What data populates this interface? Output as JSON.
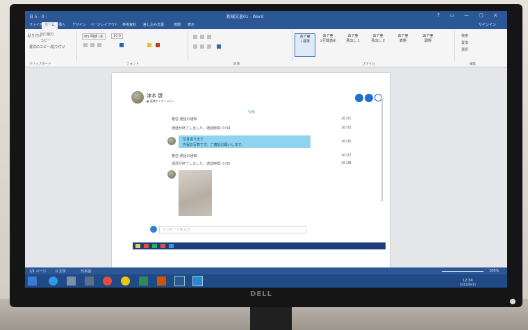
{
  "word": {
    "title": "新規文書01 - Word",
    "quick_access": "日 5 - 0 :",
    "window_controls": "? ▭ — ▢ ×",
    "user": "サインイン",
    "tabs": [
      "ファイル",
      "ホーム",
      "挿入",
      "デザイン",
      "ページレイアウト",
      "参考資料",
      "差し込み文書",
      "校閲",
      "表示"
    ],
    "active_tab": "ホーム",
    "clipboard": {
      "paste": "貼り付け",
      "cut": "切り取り",
      "copy": "コピー",
      "format_painter": "書式のコピー/貼り付け",
      "label": "クリップボード"
    },
    "font": {
      "name": "MS 明朝 (本",
      "size": "10.5",
      "label": "フォント"
    },
    "paragraph_label": "段落",
    "styles": [
      {
        "preview": "あア亜",
        "name": "↓標準"
      },
      {
        "preview": "あア亜",
        "name": "↓行間詰め"
      },
      {
        "preview": "あア亜",
        "name": "見出し 1"
      },
      {
        "preview": "あア亜",
        "name": "見出し 2"
      },
      {
        "preview": "あア亜",
        "name": "表題"
      },
      {
        "preview": "あア亜",
        "name": "副題"
      }
    ],
    "styles_label": "スタイル",
    "editing": {
      "find": "検索",
      "replace": "置換",
      "select": "選択",
      "label": "編集"
    }
  },
  "chat": {
    "contact_name": "津本 健",
    "contact_status": "● 連絡中 / オンライン",
    "date_marker": "今日",
    "messages": [
      {
        "text": "着信 通話の通知",
        "time": "10:01"
      },
      {
        "text": "通話が終了しました。通話時間: 0:04",
        "time": "10:02"
      },
      {
        "text": "確認お願いします",
        "time": "10:05"
      },
      {
        "text": "着信 通話の通知",
        "time": "10:07"
      },
      {
        "text": "通話が終了しました。通話時間: 0:05",
        "time": "10:08"
      }
    ],
    "bubble": {
      "line1": "写真送ります",
      "line2": "先程の写真です。ご確認お願いします。"
    },
    "input_placeholder": "メッセージを入力"
  },
  "statusbar": {
    "page": "1/1 ページ",
    "words": "0 文字",
    "lang": "日本語",
    "zoom": "100%"
  },
  "tray": {
    "time": "12:34",
    "date": "2015/09/15"
  },
  "monitor_brand": "DELL"
}
